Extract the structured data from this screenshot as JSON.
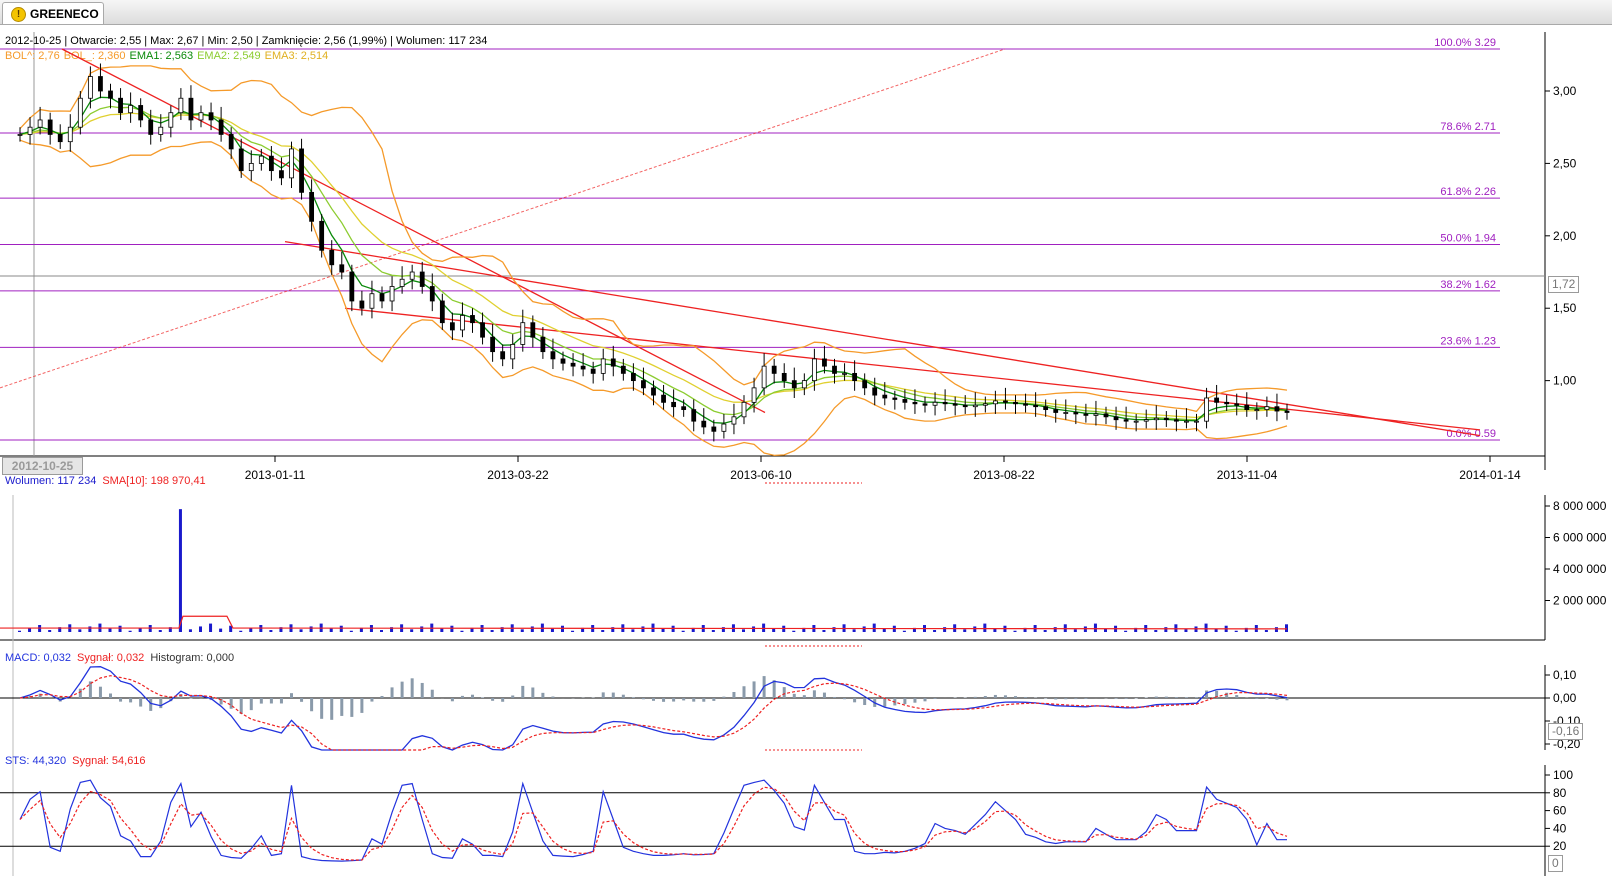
{
  "app": {
    "tab_label": "GREENECO",
    "tab_icon": "warning-icon"
  },
  "info_line": {
    "date": "2012-10-25",
    "open": "Otwarcie: 2,55",
    "max": "Max: 2,67",
    "min": "Min: 2,50",
    "close": "Zamknięcie: 2,56 (1,99%)",
    "volume": "Wolumen: 117 234"
  },
  "price_legend": {
    "bol_up": "BOL^: 2,76",
    "bol_dn": "BOL_: 2,360",
    "ema1": "EMA1: 2,563",
    "ema2": "EMA2: 2,549",
    "ema3": "EMA3: 2,514"
  },
  "volume_legend": {
    "volume": "Wolumen: 117 234",
    "sma": "SMA[10]: 198 970,41"
  },
  "macd_legend": {
    "macd": "MACD: 0,032",
    "signal": "Sygnał: 0,032",
    "histogram": "Histogram: 0,000"
  },
  "sts_legend": {
    "sts": "STS: 44,320",
    "signal": "Sygnał: 54,616"
  },
  "cursor_date": "2012-10-25",
  "price_value_box": "1,72",
  "macd_value_box": "-0,16",
  "sts_value_box": "0",
  "colors": {
    "fib": "#a020c0",
    "trend": "#ee2222",
    "bol": "#f59a2a",
    "ema1": "#0a8a0a",
    "ema2": "#8ccc30",
    "ema3": "#e0d030",
    "volume": "#1a1acc",
    "sma": "#ee2222",
    "macd": "#2233dd",
    "signal": "#ee2222",
    "hist": "#8a9aaa"
  },
  "chart_data": [
    {
      "type": "candlestick",
      "symbol": "GREENECO",
      "x_tick_labels": [
        "2013-01-11",
        "2013-03-22",
        "2013-06-10",
        "2013-08-22",
        "2013-11-04",
        "2014-01-14"
      ],
      "y_tick_labels": [
        "1,00",
        "1,50",
        "2,00",
        "2,50",
        "3,00"
      ],
      "ylim": [
        0.58,
        3.35
      ],
      "fibonacci_levels": [
        {
          "label": "100.0% 3.29",
          "value": 3.29
        },
        {
          "label": "78.6% 2.71",
          "value": 2.71
        },
        {
          "label": "61.8% 2.26",
          "value": 2.26
        },
        {
          "label": "50.0% 1.94",
          "value": 1.94
        },
        {
          "label": "38.2% 1.62",
          "value": 1.62
        },
        {
          "label": "23.6% 1.23",
          "value": 1.23
        },
        {
          "label": "0.0% 0.59",
          "value": 0.59
        }
      ],
      "close_series": [
        2.7,
        2.75,
        2.8,
        2.7,
        2.65,
        2.75,
        2.95,
        3.1,
        3.0,
        2.95,
        2.85,
        2.9,
        2.8,
        2.7,
        2.75,
        2.85,
        2.95,
        2.8,
        2.85,
        2.8,
        2.7,
        2.6,
        2.45,
        2.5,
        2.55,
        2.45,
        2.4,
        2.6,
        2.3,
        2.1,
        1.9,
        1.8,
        1.75,
        1.55,
        1.5,
        1.6,
        1.55,
        1.65,
        1.7,
        1.75,
        1.65,
        1.55,
        1.4,
        1.35,
        1.45,
        1.4,
        1.3,
        1.2,
        1.15,
        1.25,
        1.4,
        1.3,
        1.2,
        1.15,
        1.12,
        1.1,
        1.08,
        1.05,
        1.15,
        1.1,
        1.05,
        1.0,
        0.95,
        0.9,
        0.85,
        0.82,
        0.8,
        0.72,
        0.68,
        0.65,
        0.7,
        0.75,
        0.85,
        0.95,
        1.1,
        1.05,
        1.0,
        0.95,
        1.0,
        1.15,
        1.1,
        1.05,
        1.05,
        1.0,
        0.95,
        0.9,
        0.88,
        0.87,
        0.85,
        0.84,
        0.83,
        0.85,
        0.84,
        0.83,
        0.82,
        0.83,
        0.84,
        0.86,
        0.85,
        0.84,
        0.83,
        0.82,
        0.8,
        0.78,
        0.78,
        0.77,
        0.76,
        0.77,
        0.75,
        0.73,
        0.72,
        0.72,
        0.73,
        0.74,
        0.73,
        0.72,
        0.72,
        0.72,
        0.88,
        0.85,
        0.84,
        0.83,
        0.8,
        0.8,
        0.82,
        0.79,
        0.78
      ]
    },
    {
      "type": "bar",
      "name": "Wolumen",
      "y_tick_labels": [
        "2 000 000",
        "4 000 000",
        "6 000 000",
        "8 000 000"
      ],
      "ylim": [
        0,
        8000000
      ],
      "spike": {
        "label": "Wolumen",
        "value": 7800000
      },
      "sma_level": 1000000
    },
    {
      "type": "line",
      "name": "MACD",
      "y_tick_labels": [
        "0,10",
        "0,00",
        "-0,10",
        "-0,20"
      ],
      "ylim": [
        -0.25,
        0.12
      ]
    },
    {
      "type": "line",
      "name": "STS",
      "y_tick_labels": [
        "20",
        "40",
        "60",
        "80",
        "100"
      ],
      "ylim": [
        0,
        100
      ],
      "reference_lines": [
        20,
        80
      ]
    }
  ]
}
